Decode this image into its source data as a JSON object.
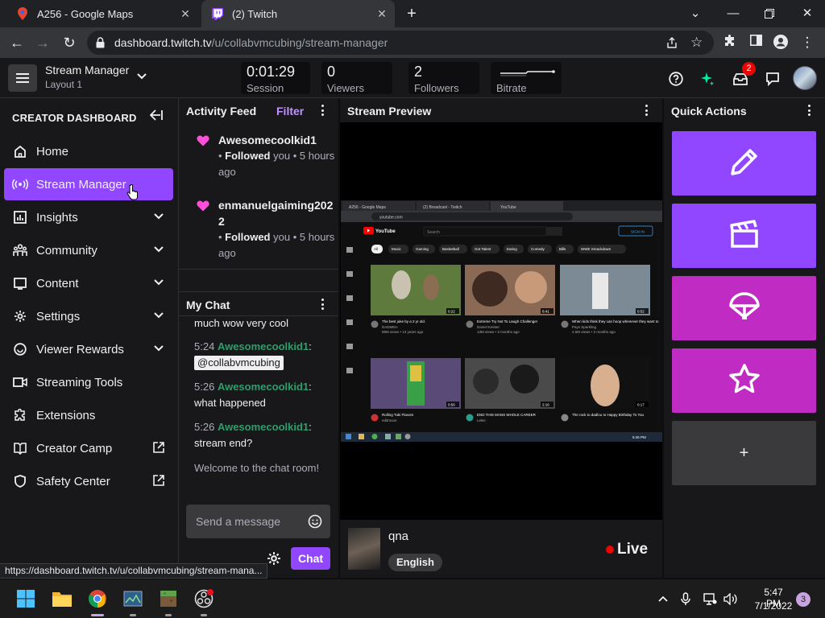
{
  "browser": {
    "tabs": [
      {
        "title": "A256 - Google Maps",
        "active": false
      },
      {
        "title": "(2) Twitch",
        "active": true
      }
    ],
    "url_host": "dashboard.twitch.tv",
    "url_path": "/u/collabvmcubing/stream-manager",
    "status_url": "https://dashboard.twitch.tv/u/collabvmcubing/stream-mana..."
  },
  "topnav": {
    "title": "Stream Manager",
    "layout": "Layout 1",
    "stats": [
      {
        "value": "0:01:29",
        "label": "Session"
      },
      {
        "value": "0",
        "label": "Viewers"
      },
      {
        "value": "2",
        "label": "Followers"
      },
      {
        "value": "",
        "label": "Bitrate"
      }
    ],
    "inbox_badge": "2"
  },
  "sidebar": {
    "title": "CREATOR DASHBOARD",
    "items": [
      {
        "label": "Home",
        "icon": "home-icon"
      },
      {
        "label": "Stream Manager",
        "icon": "broadcast-icon",
        "active": true
      },
      {
        "label": "Insights",
        "icon": "insights-icon"
      },
      {
        "label": "Community",
        "icon": "community-icon"
      },
      {
        "label": "Content",
        "icon": "content-icon"
      },
      {
        "label": "Settings",
        "icon": "gear-icon"
      },
      {
        "label": "Viewer Rewards",
        "icon": "rewards-icon"
      },
      {
        "label": "Streaming Tools",
        "icon": "camera-icon"
      },
      {
        "label": "Extensions",
        "icon": "puzzle-icon"
      },
      {
        "label": "Creator Camp",
        "icon": "book-icon"
      },
      {
        "label": "Safety Center",
        "icon": "shield-icon"
      }
    ]
  },
  "activity": {
    "title": "Activity Feed",
    "filter": "Filter",
    "events": [
      {
        "user": "Awesomecoolkid1",
        "action": "Followed",
        "target": "you",
        "time": "5 hours ago"
      },
      {
        "user": "enmanuelgaiming2022",
        "action": "Followed",
        "target": "you",
        "time": "5 hours ago"
      }
    ]
  },
  "chat": {
    "title": "My Chat",
    "partial_line": "much wow very cool",
    "messages": [
      {
        "time": "5:24",
        "user": "Awesomecoolkid1",
        "text": "@collabvmcubing"
      },
      {
        "time": "5:26",
        "user": "Awesomecoolkid1",
        "text": "what happened"
      },
      {
        "time": "5:26",
        "user": "Awesomecoolkid1",
        "text": "stream end?"
      }
    ],
    "welcome": "Welcome to the chat room!",
    "placeholder": "Send a message",
    "send_label": "Chat"
  },
  "preview": {
    "title": "Stream Preview",
    "stream_title": "qna",
    "tag": "English",
    "live_label": "Live",
    "screen": {
      "tabs": [
        "A256 - Google Maps",
        "(2) Broadcast - Twitch",
        "YouTube"
      ],
      "url": "youtube.com",
      "search_placeholder": "Search",
      "sign_in": "SIGN IN",
      "chips": [
        "All",
        "Music",
        "Gaming",
        "Basketball",
        "Got Talent",
        "Eating",
        "Comedy",
        "Bills",
        "WWE Smackdown"
      ],
      "videos": [
        {
          "title": "The best juke by a 2 yr old.",
          "channel": "DADMEH",
          "meta": "99M views • 13 years ago",
          "duration": "0:22"
        },
        {
          "title": "Extreme Try Not To Laugh Challenge!",
          "channel": "Daniel Keister",
          "meta": "13M views • 3 months ago",
          "duration": "8:41"
        },
        {
          "title": "When kids think they can hoop whenever they want to",
          "channel": "Pays Sparkling",
          "meta": "4.5M views • 2 months ago",
          "duration": "0:52"
        },
        {
          "title": "Rolling Tuki Flavors",
          "channel": "editmoon",
          "meta": "",
          "duration": "0:56"
        },
        {
          "title": "END THIS MANS WHOLE CAREER",
          "channel": "Lekie",
          "meta": "",
          "duration": "2:16"
        },
        {
          "title": "The rock to dadlou to Happy Birthday To You",
          "channel": "",
          "meta": "",
          "duration": "0:17"
        }
      ],
      "clock": "5:46 PM"
    }
  },
  "quick": {
    "title": "Quick Actions",
    "actions": [
      {
        "icon": "pencil-icon",
        "color": "#9147ff"
      },
      {
        "icon": "clapper-icon",
        "color": "#9147ff"
      },
      {
        "icon": "parachute-icon",
        "color": "#c02bc3"
      },
      {
        "icon": "star-icon",
        "color": "#c02bc3"
      },
      {
        "icon": "plus-icon",
        "color": "#3a3a3d"
      }
    ],
    "add_label": "+"
  },
  "taskbar": {
    "time": "5:47 PM",
    "date": "7/1/2022",
    "notifications": "3"
  }
}
